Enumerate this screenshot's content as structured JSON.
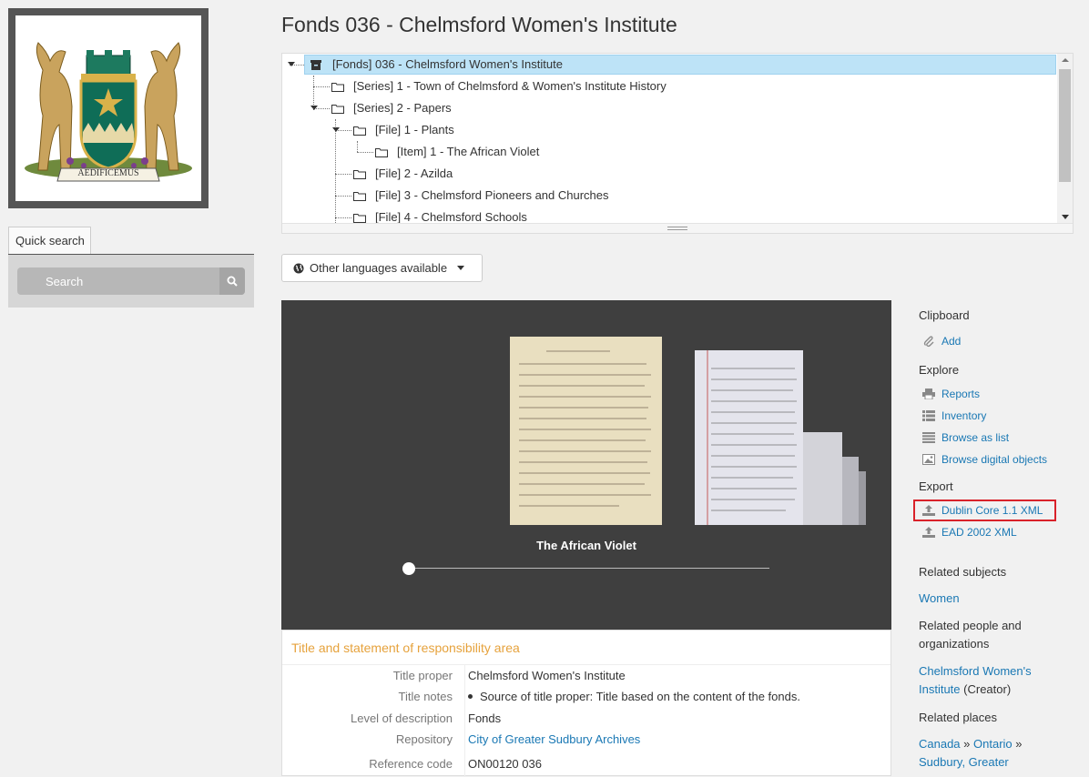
{
  "logo": {
    "motto": "AEDIFICEMUS",
    "colors": {
      "shield": "#0f6d57",
      "gold": "#d9b24a",
      "moose": "#c9a35d"
    }
  },
  "quick_search": {
    "tab_label": "Quick search",
    "placeholder": "Search"
  },
  "page": {
    "title": "Fonds 036 - Chelmsford Women's Institute"
  },
  "tree": {
    "items": [
      {
        "label": "[Fonds] 036 - Chelmsford Women's Institute",
        "icon": "archive-box-icon"
      },
      {
        "label": "[Series] 1 - Town of Chelmsford & Women's Institute History",
        "icon": "folder-icon"
      },
      {
        "label": "[Series] 2 - Papers",
        "icon": "folder-icon"
      },
      {
        "label": "[File] 1 - Plants",
        "icon": "folder-icon"
      },
      {
        "label": "[Item] 1 - The African Violet",
        "icon": "folder-icon"
      },
      {
        "label": "[File] 2 - Azilda",
        "icon": "folder-icon"
      },
      {
        "label": "[File] 3 - Chelmsford Pioneers and Churches",
        "icon": "folder-icon"
      },
      {
        "label": "[File] 4 - Chelmsford Schools",
        "icon": "folder-icon"
      }
    ]
  },
  "language": {
    "label": "Other languages available"
  },
  "carousel": {
    "current_title": "The African Violet"
  },
  "details": {
    "section_title": "Title and statement of responsibility area",
    "fields": {
      "title_proper": {
        "label": "Title proper",
        "value": "Chelmsford Women's Institute"
      },
      "title_notes": {
        "label": "Title notes",
        "value": "Source of title proper: Title based on the content of the fonds."
      },
      "level": {
        "label": "Level of description",
        "value": "Fonds"
      },
      "repository": {
        "label": "Repository",
        "value": "City of Greater Sudbury Archives"
      },
      "reference_code": {
        "label": "Reference code",
        "value": "ON00120 036"
      }
    }
  },
  "sidebar": {
    "clipboard": {
      "heading": "Clipboard",
      "add": "Add"
    },
    "explore": {
      "heading": "Explore",
      "reports": "Reports",
      "inventory": "Inventory",
      "browse_list": "Browse as list",
      "browse_digital": "Browse digital objects"
    },
    "export": {
      "heading": "Export",
      "dublin_core": "Dublin Core 1.1 XML",
      "ead": "EAD 2002 XML"
    },
    "related_subjects": {
      "heading": "Related subjects",
      "items": [
        "Women"
      ]
    },
    "related_people": {
      "heading": "Related people and organizations",
      "name": "Chelmsford Women's Institute",
      "role": " (Creator)"
    },
    "related_places": {
      "heading": "Related places",
      "place1": "Canada",
      "place2": "Ontario",
      "place3": "Sudbury, Greater",
      "separator": " » "
    }
  },
  "colors": {
    "accent": "#1a78b4",
    "section_heading": "#e6a23c",
    "highlight": "#d9222a"
  }
}
